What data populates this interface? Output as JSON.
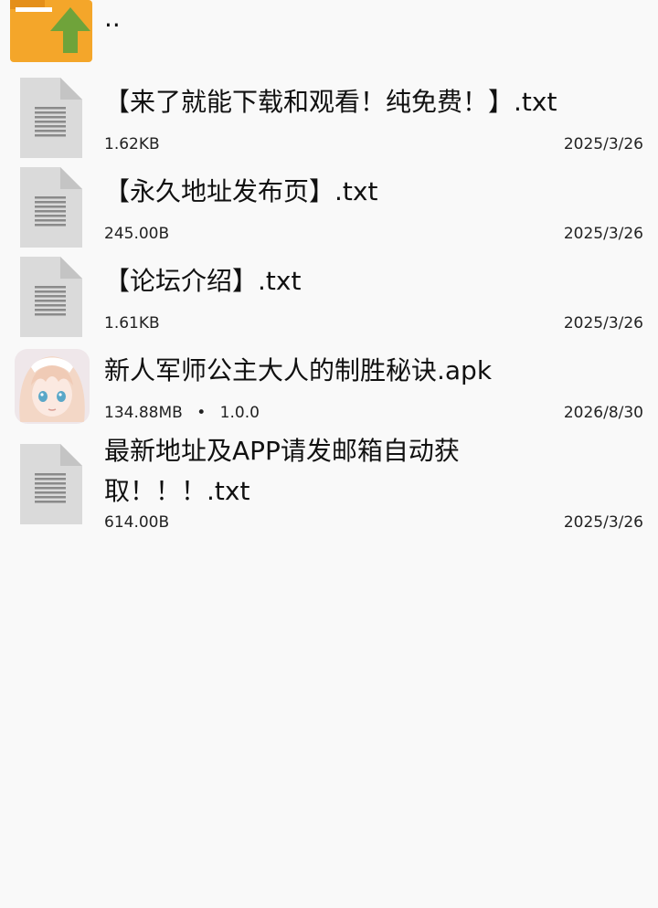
{
  "parent": {
    "label": ".."
  },
  "files": [
    {
      "name": "【来了就能下载和观看！纯免费！】.txt",
      "size": "1.62KB",
      "version": "",
      "date": "2025/3/26",
      "icon": "text-file-icon"
    },
    {
      "name": "【永久地址发布页】.txt",
      "size": "245.00B",
      "version": "",
      "date": "2025/3/26",
      "icon": "text-file-icon"
    },
    {
      "name": "【论坛介绍】.txt",
      "size": "1.61KB",
      "version": "",
      "date": "2025/3/26",
      "icon": "text-file-icon"
    },
    {
      "name": "新人军师公主大人的制胜秘诀.apk",
      "size": "134.88MB",
      "separator": "•",
      "version": "1.0.0",
      "date": "2026/8/30",
      "icon": "app-icon"
    },
    {
      "name": "最新地址及APP请发邮箱自动获取！！！.txt",
      "size": "614.00B",
      "version": "",
      "date": "2025/3/26",
      "icon": "text-file-icon"
    }
  ],
  "colors": {
    "folder": "#f4a62a",
    "folder_dark": "#e48f1a",
    "arrow": "#6fa33a",
    "doc": "#dadada",
    "doc_fold": "#c4c4c4",
    "doc_lines": "#8a8a8a"
  }
}
